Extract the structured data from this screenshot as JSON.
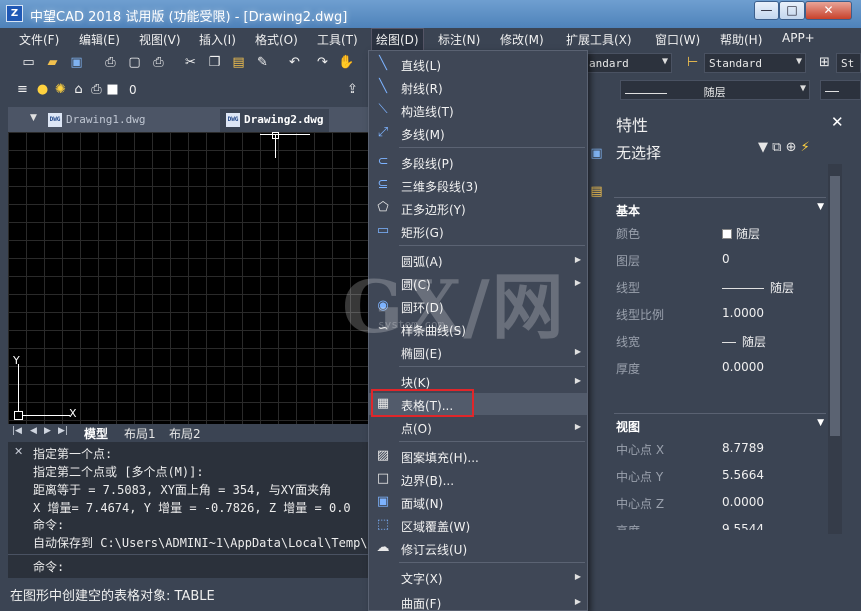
{
  "window": {
    "title": "中望CAD 2018 试用版 (功能受限) - [Drawing2.dwg]",
    "app_icon_text": "Z",
    "min_glyph": "—",
    "max_glyph": "□",
    "close_glyph": "✕"
  },
  "menubar": {
    "items": [
      "文件(F)",
      "编辑(E)",
      "视图(V)",
      "插入(I)",
      "格式(O)",
      "工具(T)",
      "绘图(D)",
      "标注(N)",
      "修改(M)",
      "扩展工具(X)",
      "窗口(W)",
      "帮助(H)",
      "APP+"
    ]
  },
  "toolbar": {
    "text_style": "andard",
    "dim_style": "Standard",
    "table_style": "St",
    "layer_value": "0",
    "linetype": "随层"
  },
  "doc_tabs": {
    "tabs": [
      "Drawing1.dwg",
      "Drawing2.dwg"
    ],
    "active": "Drawing2.dwg",
    "icon_text": "DWG"
  },
  "drawing": {
    "ucs_x": "X",
    "ucs_y": "Y"
  },
  "layout_tabs": {
    "tabs": [
      "模型",
      "布局1",
      "布局2"
    ]
  },
  "command": {
    "lines": [
      "指定第一个点:",
      "指定第二个点或 [多个点(M)]:",
      "距离等于 = 7.5083,  XY面上角 = 354,  与XY面夹角",
      "X 增量= 7.4674,  Y 增量 = -0.7826,  Z 增量 = 0.0",
      "命令:",
      "自动保存到 C:\\Users\\ADMINI~1\\AppData\\Local\\Temp\\",
      "命令:"
    ]
  },
  "status": {
    "text": "在图形中创建空的表格对象: TABLE"
  },
  "draw_menu": {
    "items": [
      {
        "label": "直线(L)",
        "icon": "line-icon"
      },
      {
        "label": "射线(R)",
        "icon": "ray-icon"
      },
      {
        "label": "构造线(T)",
        "icon": "xline-icon"
      },
      {
        "label": "多线(M)",
        "icon": "multiline-icon"
      },
      {
        "label": "多段线(P)",
        "icon": "polyline-icon"
      },
      {
        "label": "三维多段线(3)",
        "icon": "3d-polyline-icon"
      },
      {
        "label": "正多边形(Y)",
        "icon": "polygon-icon"
      },
      {
        "label": "矩形(G)",
        "icon": "rectangle-icon"
      },
      {
        "label": "圆弧(A)",
        "icon": "arc-icon",
        "submenu": true
      },
      {
        "label": "圆(C)",
        "icon": "circle-icon",
        "submenu": true
      },
      {
        "label": "圆环(D)",
        "icon": "donut-icon"
      },
      {
        "label": "样条曲线(S)",
        "icon": "spline-icon"
      },
      {
        "label": "椭圆(E)",
        "icon": "ellipse-icon",
        "submenu": true
      },
      {
        "label": "块(K)",
        "icon": "block-icon",
        "submenu": true
      },
      {
        "label": "表格(T)...",
        "icon": "table-icon",
        "highlighted": true
      },
      {
        "label": "点(O)",
        "icon": "point-icon",
        "submenu": true
      },
      {
        "label": "图案填充(H)...",
        "icon": "hatch-icon"
      },
      {
        "label": "边界(B)...",
        "icon": "boundary-icon"
      },
      {
        "label": "面域(N)",
        "icon": "region-icon"
      },
      {
        "label": "区域覆盖(W)",
        "icon": "wipeout-icon"
      },
      {
        "label": "修订云线(U)",
        "icon": "revcloud-icon"
      },
      {
        "label": "文字(X)",
        "icon": "text-icon",
        "submenu": true
      },
      {
        "label": "曲面(F)",
        "icon": "surface-icon",
        "submenu": true
      }
    ]
  },
  "properties": {
    "title": "特性",
    "selection": "无选择",
    "sections": {
      "basic": "基本",
      "view": "视图"
    },
    "basic_rows": [
      {
        "key": "颜色",
        "value": "随层"
      },
      {
        "key": "图层",
        "value": "0"
      },
      {
        "key": "线型",
        "value": "随层"
      },
      {
        "key": "线型比例",
        "value": "1.0000"
      },
      {
        "key": "线宽",
        "value": "随层"
      },
      {
        "key": "厚度",
        "value": "0.0000"
      }
    ],
    "view_rows": [
      {
        "key": "中心点 X",
        "value": "8.7789"
      },
      {
        "key": "中心点 Y",
        "value": "5.5664"
      },
      {
        "key": "中心点 Z",
        "value": "0.0000"
      },
      {
        "key": "高度",
        "value": "9.5544"
      }
    ]
  },
  "watermark": {
    "text": "GX/网",
    "sub": "system.com"
  }
}
